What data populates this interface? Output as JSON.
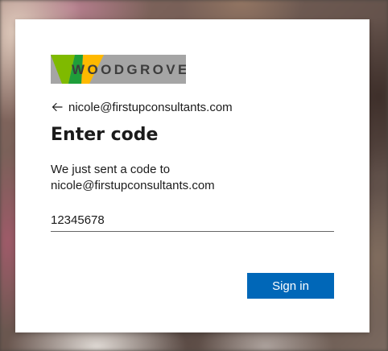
{
  "brand": {
    "logo_text": "WOODGROVE",
    "logo_bg_color": "#a5a5a5",
    "logo_colors": [
      "#7fba00",
      "#ffb900"
    ]
  },
  "identity": {
    "back_icon": "arrow-left-icon",
    "email": "nicole@firstupconsultants.com"
  },
  "title": "Enter code",
  "description": {
    "line1": "We just sent a code to",
    "line2": "nicole@firstupconsultants.com"
  },
  "code_input": {
    "value": "12345678"
  },
  "signin_button": {
    "label": "Sign in",
    "color": "#0067b8"
  }
}
